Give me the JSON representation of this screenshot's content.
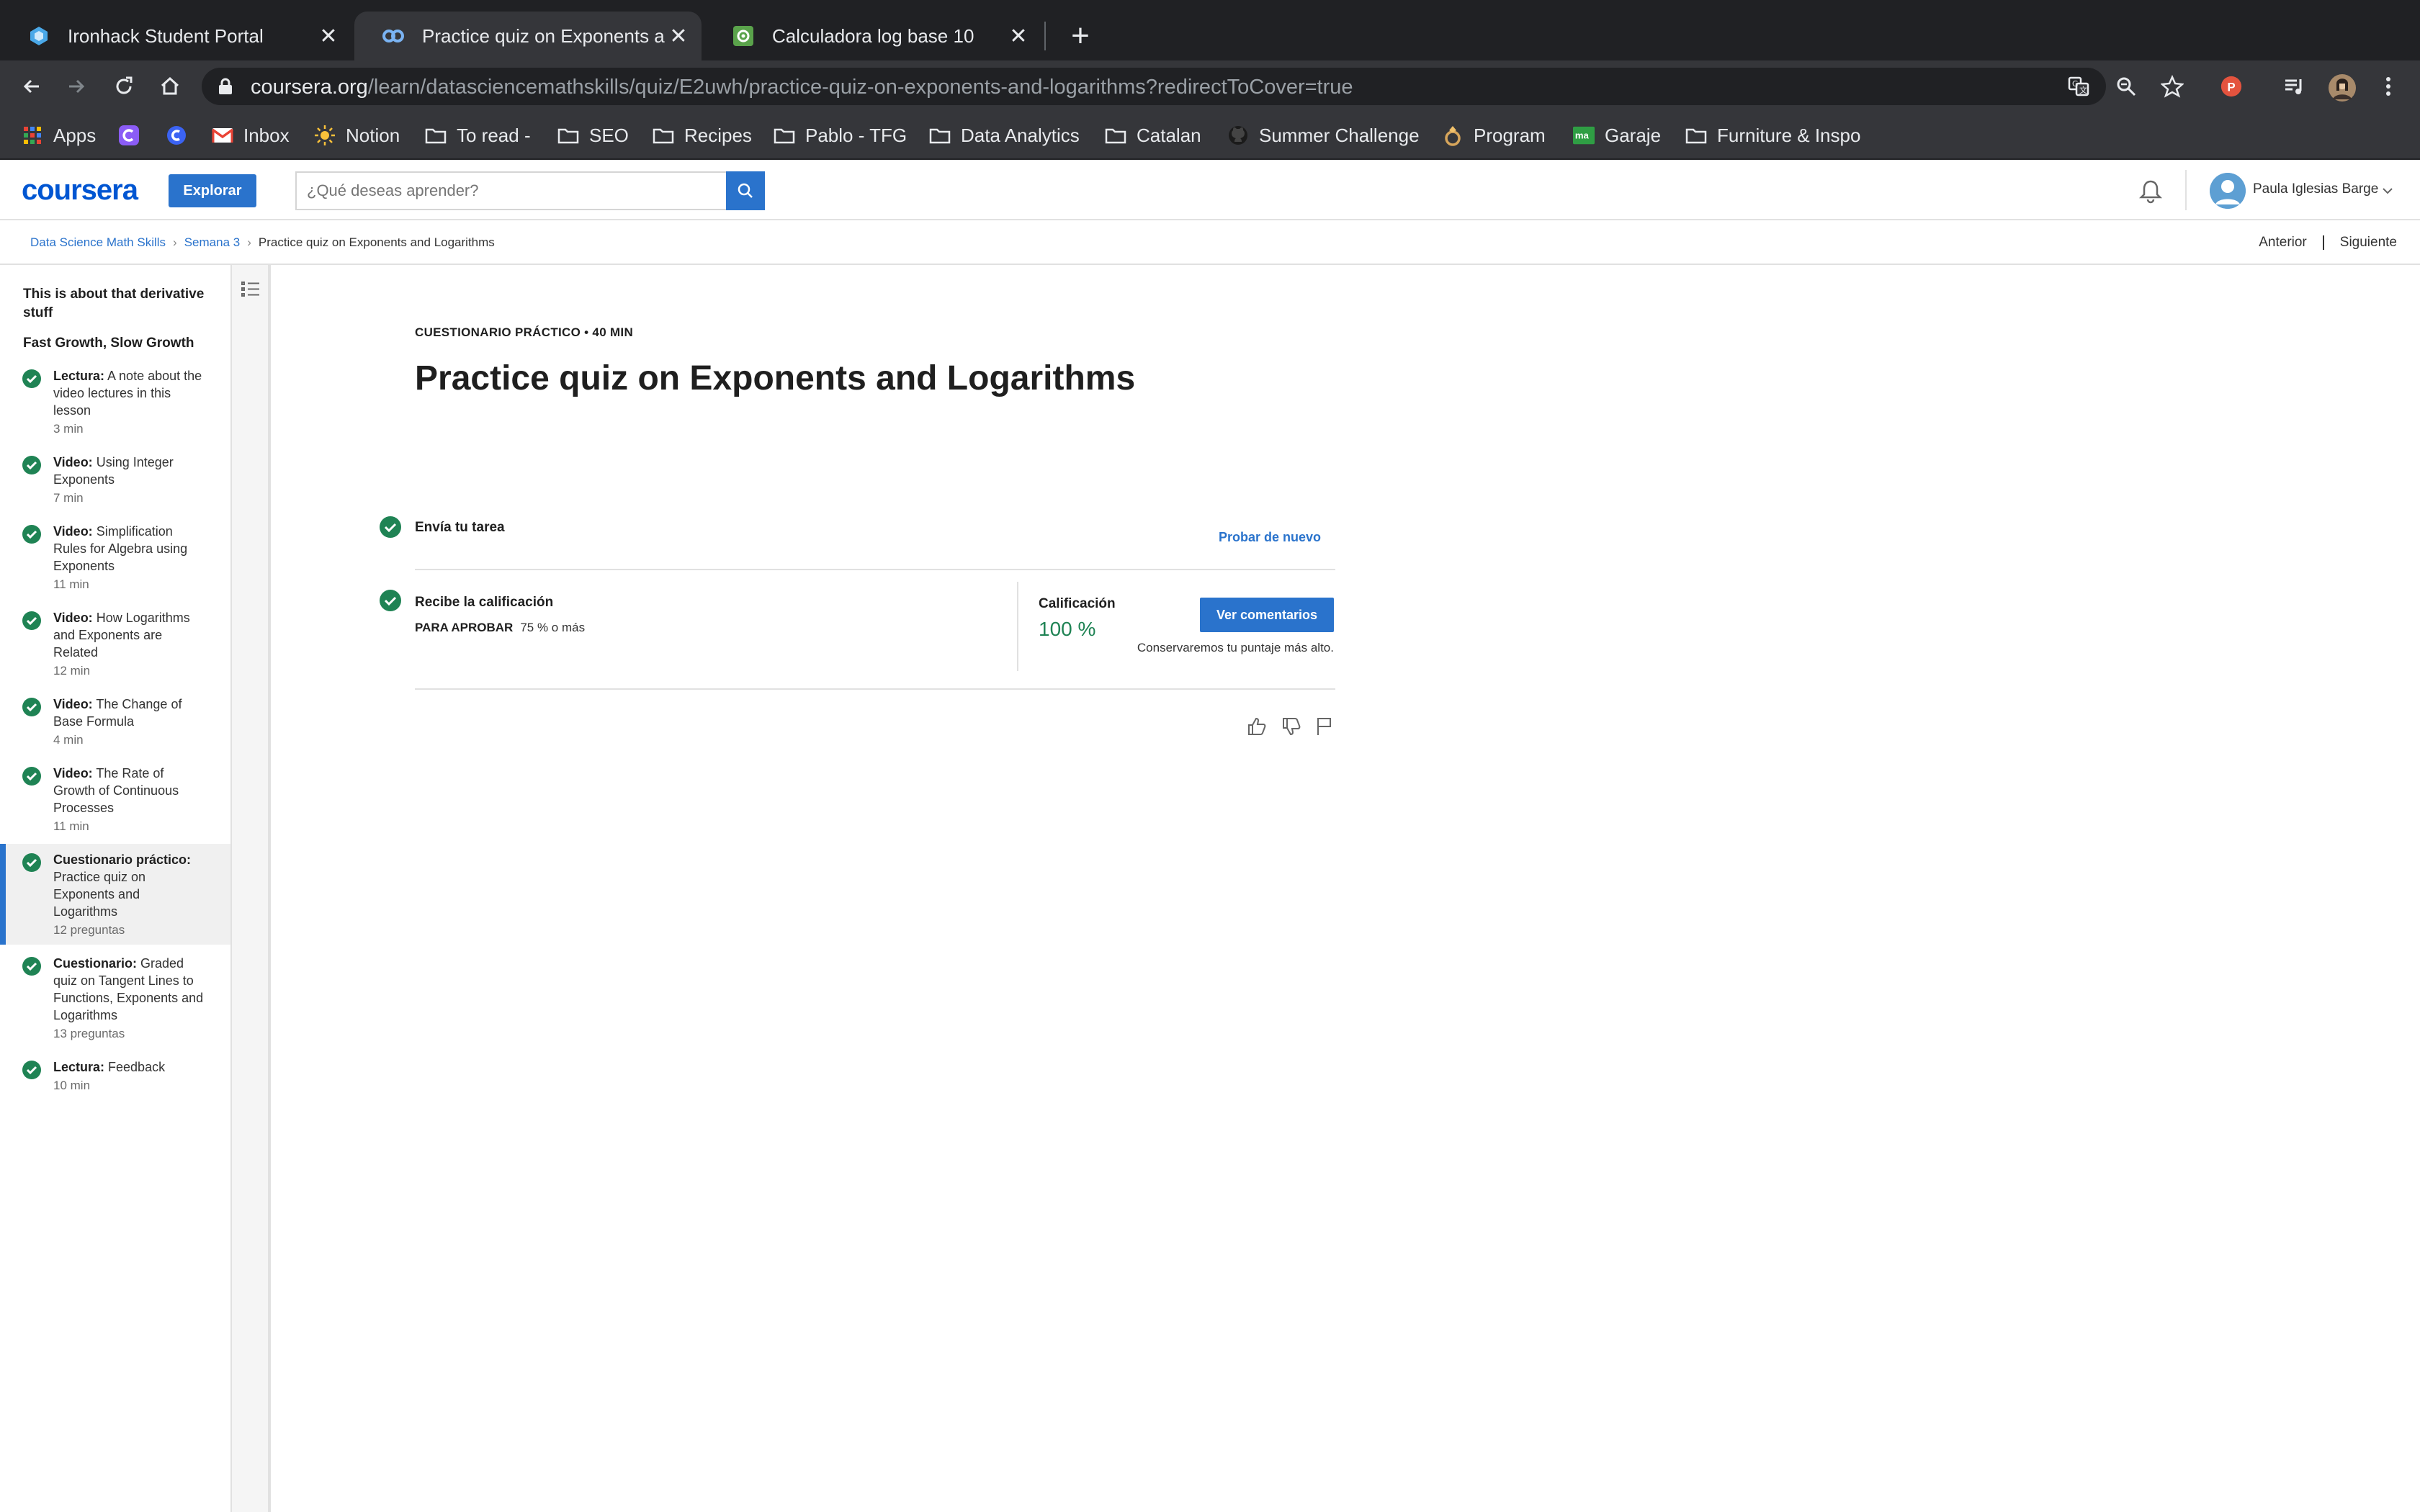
{
  "browser": {
    "tabs": [
      {
        "title": "Ironhack Student Portal",
        "icon": "ironhack-icon",
        "active": false
      },
      {
        "title": "Practice quiz on Exponents and Logarithms | Coursera",
        "icon": "coursera-icon",
        "active": true
      },
      {
        "title": "Calculadora log base 10",
        "icon": "calculator-favicon-icon",
        "active": false
      }
    ],
    "url_host": "coursera.org",
    "url_path": "/learn/datasciencemathskills/quiz/E2uwh/practice-quiz-on-exponents-and-logarithms?redirectToCover=true",
    "profile_letter": "P",
    "bookmarks": [
      {
        "label": "Apps",
        "icon": "apps-grid-icon"
      },
      {
        "label": "",
        "icon": "app-icon-purple"
      },
      {
        "label": "",
        "icon": "app-icon-blue"
      },
      {
        "label": "Inbox",
        "icon": "gmail-icon"
      },
      {
        "label": "Notion",
        "icon": "sun-icon"
      },
      {
        "label": "To read -",
        "icon": "folder-icon"
      },
      {
        "label": "SEO",
        "icon": "folder-icon"
      },
      {
        "label": "Recipes",
        "icon": "folder-icon"
      },
      {
        "label": "Pablo - TFG",
        "icon": "folder-icon"
      },
      {
        "label": "Data Analytics",
        "icon": "folder-icon"
      },
      {
        "label": "Catalan",
        "icon": "folder-icon"
      },
      {
        "label": "Summer Challenge",
        "icon": "github-icon"
      },
      {
        "label": "Program",
        "icon": "ring-icon"
      },
      {
        "label": "Garaje",
        "icon": "ma-icon"
      },
      {
        "label": "Furniture & Inspo",
        "icon": "folder-icon"
      }
    ]
  },
  "header": {
    "logo": "coursera",
    "explore_label": "Explorar",
    "search_placeholder": "¿Qué deseas aprender?",
    "user_name": "Paula Iglesias Barge"
  },
  "breadcrumb": {
    "items": [
      "Data Science Math Skills",
      "Semana 3",
      "Practice quiz on Exponents and Logarithms"
    ],
    "prev_label": "Anterior",
    "next_label": "Siguiente"
  },
  "sidebar": {
    "title": "This is about that derivative stuff",
    "section": "Fast Growth, Slow Growth",
    "items": [
      {
        "type": "Lectura:",
        "name": "A note about the video lectures in this lesson",
        "meta": "3 min",
        "completed": true,
        "active": false
      },
      {
        "type": "Video:",
        "name": "Using Integer Exponents",
        "meta": "7 min",
        "completed": true,
        "active": false
      },
      {
        "type": "Video:",
        "name": "Simplification Rules for Algebra using Exponents",
        "meta": "11 min",
        "completed": true,
        "active": false
      },
      {
        "type": "Video:",
        "name": "How Logarithms and Exponents are Related",
        "meta": "12 min",
        "completed": true,
        "active": false
      },
      {
        "type": "Video:",
        "name": "The Change of Base Formula",
        "meta": "4 min",
        "completed": true,
        "active": false
      },
      {
        "type": "Video:",
        "name": "The Rate of Growth of Continuous Processes",
        "meta": "11 min",
        "completed": true,
        "active": false
      },
      {
        "type": "Cuestionario práctico:",
        "name": "Practice quiz on Exponents and Logarithms",
        "meta": "12 preguntas",
        "completed": true,
        "active": true
      },
      {
        "type": "Cuestionario:",
        "name": "Graded quiz on Tangent Lines to Functions, Exponents and Logarithms",
        "meta": "13 preguntas",
        "completed": true,
        "active": false
      },
      {
        "type": "Lectura:",
        "name": "Feedback",
        "meta": "10 min",
        "completed": true,
        "active": false
      }
    ]
  },
  "main": {
    "kicker": "CUESTIONARIO PRÁCTICO • 40 MIN",
    "title": "Practice quiz on Exponents and Logarithms",
    "step1_label": "Envía tu tarea",
    "retry_label": "Probar de nuevo",
    "step2_label": "Recibe la calificación",
    "pass_label": "PARA APROBAR",
    "pass_value": "75 % o más",
    "grade_label": "Calificación",
    "grade_value": "100 %",
    "comments_button": "Ver comentarios",
    "keep_note": "Conservaremos tu puntaje más alto."
  },
  "colors": {
    "coursera_blue": "#2a73cc",
    "success_green": "#1f8354",
    "chrome_dark": "#202124",
    "chrome_toolbar": "#35363a"
  }
}
